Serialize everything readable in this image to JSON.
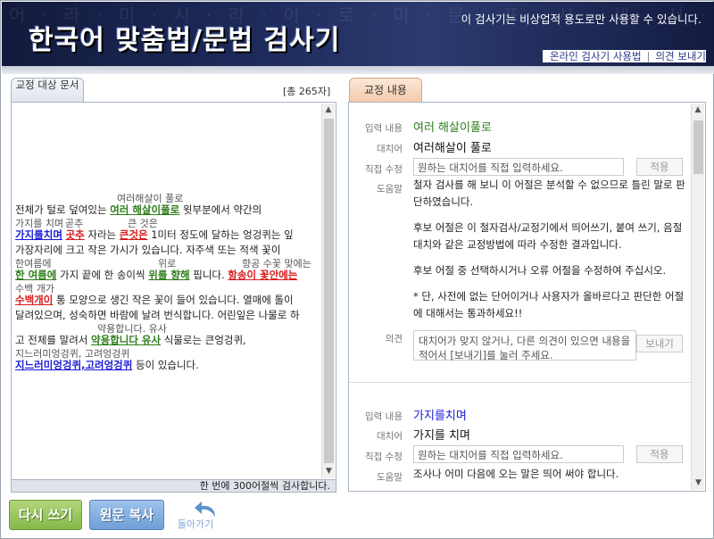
{
  "header": {
    "title": "한국어 맞춤법/문법 검사기",
    "notice": "이 검사기는 비상업적 용도로만 사용할 수 있습니다.",
    "background_text": "어 · 라 · 미 · 시 · 라 · 이 · 로 · 미 · 문 · 표 · 사 · 세 · 서 · 술 · 어 · 라",
    "links": [
      "온라인 검사기 사용법",
      "의견 보내기"
    ]
  },
  "left_panel": {
    "tab_label": "교정 대상 문서",
    "char_count": "[총 265자]",
    "status": "한 번에 300어절씩 검사합니다."
  },
  "document": [
    {
      "suggestions": [
        {
          "text": "여러해살이 풀로",
          "offset": 114
        }
      ],
      "segments": [
        {
          "text": "전체가 털로 덮여있는 ",
          "style": ""
        },
        {
          "text": "여러 해살이풀로",
          "style": "g ul"
        },
        {
          "text": " 윗부분에서 약간의",
          "style": ""
        }
      ]
    },
    {
      "suggestions": [
        {
          "text": "가지를 치며",
          "offset": 0
        },
        {
          "text": "곧추",
          "offset": 56
        },
        {
          "text": "큰 것은",
          "offset": 126
        }
      ],
      "segments": [
        {
          "text": "가지를치며",
          "style": "b ul"
        },
        {
          "text": " ",
          "style": ""
        },
        {
          "text": "곳추",
          "style": "r ul"
        },
        {
          "text": " 자라는 ",
          "style": ""
        },
        {
          "text": "큰것은",
          "style": "r ul"
        },
        {
          "text": " 1미터 정도에 달하는 엉겅퀴는 잎",
          "style": ""
        }
      ]
    },
    {
      "suggestions": [],
      "segments": [
        {
          "text": "가장자리에 크고 작은 가시가 있습니다. 자주색 또는 적색 꽃이",
          "style": ""
        }
      ]
    },
    {
      "suggestions": [
        {
          "text": "한여름에",
          "offset": 0
        },
        {
          "text": "위로",
          "offset": 160
        },
        {
          "text": "향공 수꽃 맞에는",
          "offset": 254
        }
      ],
      "segments": [
        {
          "text": "한 여름에",
          "style": "g ul"
        },
        {
          "text": " 가지 끝에 한 송이씩 ",
          "style": ""
        },
        {
          "text": "위를 향해",
          "style": "g ul"
        },
        {
          "text": " 핍니다. ",
          "style": ""
        },
        {
          "text": "항송이 꽃안에는",
          "style": "r ul"
        }
      ]
    },
    {
      "suggestions": [
        {
          "text": "수백 개가",
          "offset": 0
        }
      ],
      "segments": [
        {
          "text": "수백개이",
          "style": "r ul"
        },
        {
          "text": " 통 모양으로 생긴 작은 꽃이 들어 있습니다. 열매에 톨이",
          "style": ""
        }
      ]
    },
    {
      "suggestions": [],
      "segments": [
        {
          "text": "달려있으며, 성숙하면 바람에 날려 번식합니다. 어린잎은 나물로 하",
          "style": ""
        }
      ]
    },
    {
      "suggestions": [
        {
          "text": "약용합니다. 유사",
          "offset": 92
        }
      ],
      "segments": [
        {
          "text": "고 전체를 말려서 ",
          "style": ""
        },
        {
          "text": "약용합니다 유사",
          "style": "g ul"
        },
        {
          "text": " 식물로는 큰엉겅퀴,",
          "style": ""
        }
      ]
    },
    {
      "suggestions": [
        {
          "text": "지느러미엉겅퀴, 고려엉겅퀴",
          "offset": 0
        }
      ],
      "segments": [
        {
          "text": "지느러미엉겅퀴,고려엉겅퀴",
          "style": "b ul"
        },
        {
          "text": " 등이 있습니다.",
          "style": ""
        }
      ]
    }
  ],
  "right_panel": {
    "tab_label": "교정 내용",
    "labels": {
      "input": "입력 내용",
      "replace": "대치어",
      "direct_edit": "직접 수정",
      "help": "도움말",
      "opinion": "의견"
    },
    "direct_placeholder": "원하는 대치어를 직접 입력하세요.",
    "apply_label": "적용",
    "opinion_placeholder": "대치어가 맞지 않거나, 다른 의견이 있으면 내용을 적어서 [보내기]를 눌러 주세요.",
    "send_label": "보내기",
    "items": [
      {
        "input": "여러 해살이풀로",
        "input_color": "#2e7d1b",
        "replacement": "여러해살이 풀로",
        "help": [
          "철자 검사를 해 보니 이 어절은 분석할 수 없으므로 틀린 말로 판단하였습니다.",
          "후보 어절은 이 철자검사/교정기에서 띄어쓰기, 붙여 쓰기, 음절대치와 같은 교정방법에 따라 수정한 결과입니다.",
          "후보 어절 중 선택하시거나 오류 어절을 수정하여 주십시오.",
          "* 단, 사전에 없는 단어이거나 사용자가 올바르다고 판단한 어절에 대해서는 통과하세요!!"
        ]
      },
      {
        "input": "가지를치며",
        "input_color": "#1b1bd8",
        "replacement": "가지를 치며",
        "help": [
          "조사나 어미 다음에 오는 말은 띄어 써야 합니다."
        ]
      }
    ]
  },
  "buttons": {
    "rewrite": "다시 쓰기",
    "copy": "원문 복사",
    "back": "돌아가기"
  },
  "colors": {
    "header_bg": "#1d2a5a",
    "correct_suggestion_green": "#2e7d1b",
    "spacing_error_blue": "#1b1bd8",
    "spelling_error_red": "#d81b1b",
    "rewrite_button": "#86b84a",
    "copy_button": "#6f9ed6"
  }
}
